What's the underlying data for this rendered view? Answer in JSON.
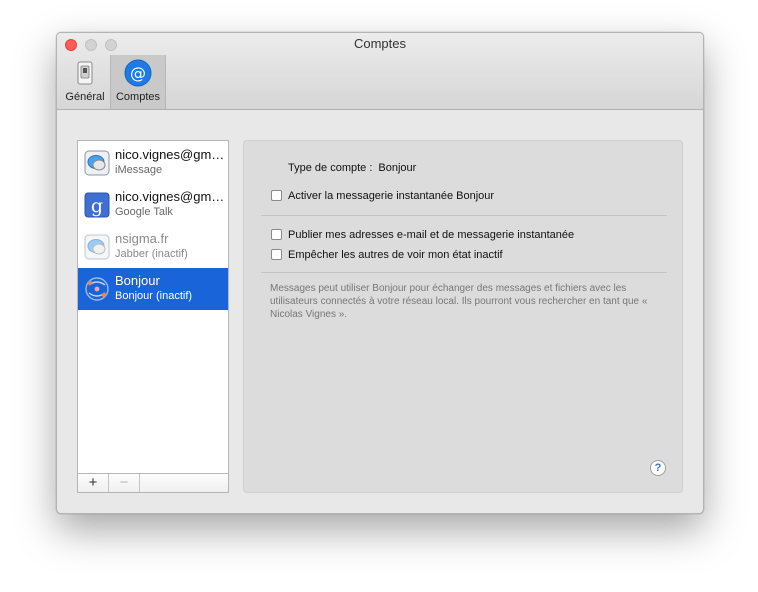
{
  "window": {
    "title": "Comptes"
  },
  "toolbar": {
    "items": [
      {
        "label": "Général",
        "icon": "general-icon",
        "selected": false
      },
      {
        "label": "Comptes",
        "icon": "at-sign-icon",
        "selected": true
      }
    ]
  },
  "accounts": [
    {
      "name": "nico.vignes@gmail.com",
      "service": "iMessage",
      "icon": "imessage-icon",
      "state": "active"
    },
    {
      "name": "nico.vignes@gmail.com",
      "service": "Google Talk",
      "icon": "google-icon",
      "state": "active"
    },
    {
      "name": "nsigma.fr",
      "service": "Jabber (inactif)",
      "icon": "jabber-icon",
      "state": "inactive"
    },
    {
      "name": "Bonjour",
      "service": "Bonjour (inactif)",
      "icon": "bonjour-icon",
      "state": "selected"
    }
  ],
  "list_controls": {
    "add": "+",
    "remove": "−"
  },
  "detail": {
    "type_label": "Type de compte :",
    "type_value": "Bonjour",
    "enable_label": "Activer la messagerie instantanée Bonjour",
    "publish_label": "Publier mes adresses e-mail et de messagerie instantanée",
    "block_label": "Empêcher les autres de voir mon état inactif",
    "description": "Messages peut utiliser Bonjour pour échanger des messages et fichiers avec les utilisateurs connectés à votre réseau local. Ils pourront vous rechercher en tant que « Nicolas Vignes ».",
    "help": "?"
  },
  "colors": {
    "selection": "#1864d8",
    "close_button": "#fc5b57",
    "accent_blue": "#1e7be6"
  }
}
